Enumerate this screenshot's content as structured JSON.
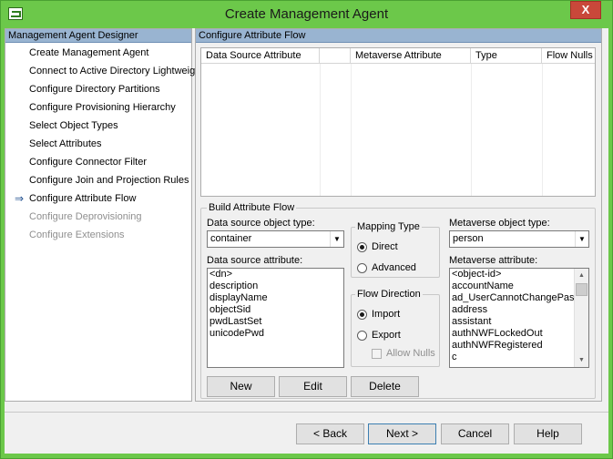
{
  "window": {
    "title": "Create Management Agent",
    "close_label": "X"
  },
  "sidebar": {
    "header": "Management Agent Designer",
    "items": [
      {
        "label": "Create Management Agent",
        "state": "normal"
      },
      {
        "label": "Connect to Active Directory Lightweig",
        "state": "normal"
      },
      {
        "label": "Configure Directory Partitions",
        "state": "normal"
      },
      {
        "label": "Configure Provisioning Hierarchy",
        "state": "normal"
      },
      {
        "label": "Select Object Types",
        "state": "normal"
      },
      {
        "label": "Select Attributes",
        "state": "normal"
      },
      {
        "label": "Configure Connector Filter",
        "state": "normal"
      },
      {
        "label": "Configure Join and Projection Rules",
        "state": "normal"
      },
      {
        "label": "Configure Attribute Flow",
        "state": "current"
      },
      {
        "label": "Configure Deprovisioning",
        "state": "disabled"
      },
      {
        "label": "Configure Extensions",
        "state": "disabled"
      }
    ]
  },
  "main": {
    "header": "Configure Attribute Flow",
    "grid": {
      "columns": [
        "Data Source Attribute",
        "",
        "Metaverse Attribute",
        "Type",
        "Flow Nulls"
      ]
    },
    "build": {
      "title": "Build Attribute Flow",
      "ds_object_type_label": "Data source object type:",
      "ds_object_type_value": "container",
      "ds_attribute_label": "Data source attribute:",
      "ds_attributes": [
        "<dn>",
        "description",
        "displayName",
        "objectSid",
        "pwdLastSet",
        "unicodePwd"
      ],
      "mapping_type": {
        "title": "Mapping Type",
        "direct": "Direct",
        "advanced": "Advanced",
        "selected": "Direct"
      },
      "flow_direction": {
        "title": "Flow Direction",
        "import": "Import",
        "export": "Export",
        "allow_nulls": "Allow Nulls",
        "selected": "Import"
      },
      "mv_object_type_label": "Metaverse object type:",
      "mv_object_type_value": "person",
      "mv_attribute_label": "Metaverse attribute:",
      "mv_attributes": [
        "<object-id>",
        "accountName",
        "ad_UserCannotChangePass",
        "address",
        "assistant",
        "authNWFLockedOut",
        "authNWFRegistered",
        "c"
      ],
      "buttons": {
        "new": "New",
        "edit": "Edit",
        "delete": "Delete"
      }
    }
  },
  "footer": {
    "back": "< Back",
    "next": "Next >",
    "cancel": "Cancel",
    "help": "Help"
  },
  "icons": {
    "combo_arrow": "▼",
    "scroll_up": "▲",
    "scroll_down": "▼",
    "current_step": "⇒"
  },
  "colors": {
    "title_bar": "#6cc84a",
    "panel_header": "#99b4d1",
    "close_button": "#c9483a"
  }
}
